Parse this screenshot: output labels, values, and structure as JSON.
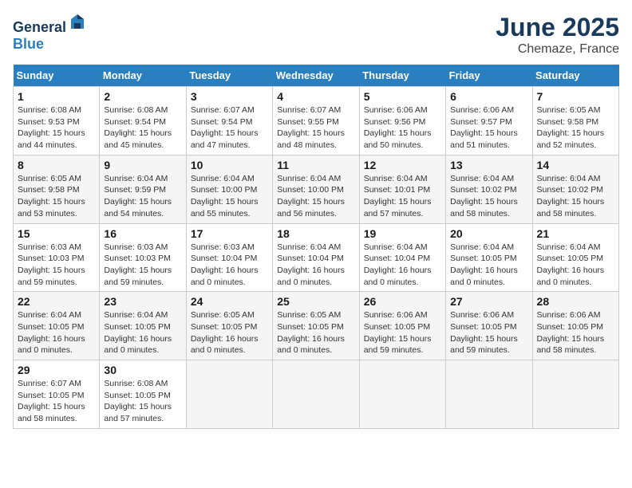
{
  "header": {
    "logo_general": "General",
    "logo_blue": "Blue",
    "month_year": "June 2025",
    "location": "Chemaze, France"
  },
  "weekdays": [
    "Sunday",
    "Monday",
    "Tuesday",
    "Wednesday",
    "Thursday",
    "Friday",
    "Saturday"
  ],
  "weeks": [
    [
      {
        "day": "1",
        "sunrise": "Sunrise: 6:08 AM",
        "sunset": "Sunset: 9:53 PM",
        "daylight": "Daylight: 15 hours and 44 minutes."
      },
      {
        "day": "2",
        "sunrise": "Sunrise: 6:08 AM",
        "sunset": "Sunset: 9:54 PM",
        "daylight": "Daylight: 15 hours and 45 minutes."
      },
      {
        "day": "3",
        "sunrise": "Sunrise: 6:07 AM",
        "sunset": "Sunset: 9:54 PM",
        "daylight": "Daylight: 15 hours and 47 minutes."
      },
      {
        "day": "4",
        "sunrise": "Sunrise: 6:07 AM",
        "sunset": "Sunset: 9:55 PM",
        "daylight": "Daylight: 15 hours and 48 minutes."
      },
      {
        "day": "5",
        "sunrise": "Sunrise: 6:06 AM",
        "sunset": "Sunset: 9:56 PM",
        "daylight": "Daylight: 15 hours and 50 minutes."
      },
      {
        "day": "6",
        "sunrise": "Sunrise: 6:06 AM",
        "sunset": "Sunset: 9:57 PM",
        "daylight": "Daylight: 15 hours and 51 minutes."
      },
      {
        "day": "7",
        "sunrise": "Sunrise: 6:05 AM",
        "sunset": "Sunset: 9:58 PM",
        "daylight": "Daylight: 15 hours and 52 minutes."
      }
    ],
    [
      {
        "day": "8",
        "sunrise": "Sunrise: 6:05 AM",
        "sunset": "Sunset: 9:58 PM",
        "daylight": "Daylight: 15 hours and 53 minutes."
      },
      {
        "day": "9",
        "sunrise": "Sunrise: 6:04 AM",
        "sunset": "Sunset: 9:59 PM",
        "daylight": "Daylight: 15 hours and 54 minutes."
      },
      {
        "day": "10",
        "sunrise": "Sunrise: 6:04 AM",
        "sunset": "Sunset: 10:00 PM",
        "daylight": "Daylight: 15 hours and 55 minutes."
      },
      {
        "day": "11",
        "sunrise": "Sunrise: 6:04 AM",
        "sunset": "Sunset: 10:00 PM",
        "daylight": "Daylight: 15 hours and 56 minutes."
      },
      {
        "day": "12",
        "sunrise": "Sunrise: 6:04 AM",
        "sunset": "Sunset: 10:01 PM",
        "daylight": "Daylight: 15 hours and 57 minutes."
      },
      {
        "day": "13",
        "sunrise": "Sunrise: 6:04 AM",
        "sunset": "Sunset: 10:02 PM",
        "daylight": "Daylight: 15 hours and 58 minutes."
      },
      {
        "day": "14",
        "sunrise": "Sunrise: 6:04 AM",
        "sunset": "Sunset: 10:02 PM",
        "daylight": "Daylight: 15 hours and 58 minutes."
      }
    ],
    [
      {
        "day": "15",
        "sunrise": "Sunrise: 6:03 AM",
        "sunset": "Sunset: 10:03 PM",
        "daylight": "Daylight: 15 hours and 59 minutes."
      },
      {
        "day": "16",
        "sunrise": "Sunrise: 6:03 AM",
        "sunset": "Sunset: 10:03 PM",
        "daylight": "Daylight: 15 hours and 59 minutes."
      },
      {
        "day": "17",
        "sunrise": "Sunrise: 6:03 AM",
        "sunset": "Sunset: 10:04 PM",
        "daylight": "Daylight: 16 hours and 0 minutes."
      },
      {
        "day": "18",
        "sunrise": "Sunrise: 6:04 AM",
        "sunset": "Sunset: 10:04 PM",
        "daylight": "Daylight: 16 hours and 0 minutes."
      },
      {
        "day": "19",
        "sunrise": "Sunrise: 6:04 AM",
        "sunset": "Sunset: 10:04 PM",
        "daylight": "Daylight: 16 hours and 0 minutes."
      },
      {
        "day": "20",
        "sunrise": "Sunrise: 6:04 AM",
        "sunset": "Sunset: 10:05 PM",
        "daylight": "Daylight: 16 hours and 0 minutes."
      },
      {
        "day": "21",
        "sunrise": "Sunrise: 6:04 AM",
        "sunset": "Sunset: 10:05 PM",
        "daylight": "Daylight: 16 hours and 0 minutes."
      }
    ],
    [
      {
        "day": "22",
        "sunrise": "Sunrise: 6:04 AM",
        "sunset": "Sunset: 10:05 PM",
        "daylight": "Daylight: 16 hours and 0 minutes."
      },
      {
        "day": "23",
        "sunrise": "Sunrise: 6:04 AM",
        "sunset": "Sunset: 10:05 PM",
        "daylight": "Daylight: 16 hours and 0 minutes."
      },
      {
        "day": "24",
        "sunrise": "Sunrise: 6:05 AM",
        "sunset": "Sunset: 10:05 PM",
        "daylight": "Daylight: 16 hours and 0 minutes."
      },
      {
        "day": "25",
        "sunrise": "Sunrise: 6:05 AM",
        "sunset": "Sunset: 10:05 PM",
        "daylight": "Daylight: 16 hours and 0 minutes."
      },
      {
        "day": "26",
        "sunrise": "Sunrise: 6:06 AM",
        "sunset": "Sunset: 10:05 PM",
        "daylight": "Daylight: 15 hours and 59 minutes."
      },
      {
        "day": "27",
        "sunrise": "Sunrise: 6:06 AM",
        "sunset": "Sunset: 10:05 PM",
        "daylight": "Daylight: 15 hours and 59 minutes."
      },
      {
        "day": "28",
        "sunrise": "Sunrise: 6:06 AM",
        "sunset": "Sunset: 10:05 PM",
        "daylight": "Daylight: 15 hours and 58 minutes."
      }
    ],
    [
      {
        "day": "29",
        "sunrise": "Sunrise: 6:07 AM",
        "sunset": "Sunset: 10:05 PM",
        "daylight": "Daylight: 15 hours and 58 minutes."
      },
      {
        "day": "30",
        "sunrise": "Sunrise: 6:08 AM",
        "sunset": "Sunset: 10:05 PM",
        "daylight": "Daylight: 15 hours and 57 minutes."
      },
      null,
      null,
      null,
      null,
      null
    ]
  ]
}
